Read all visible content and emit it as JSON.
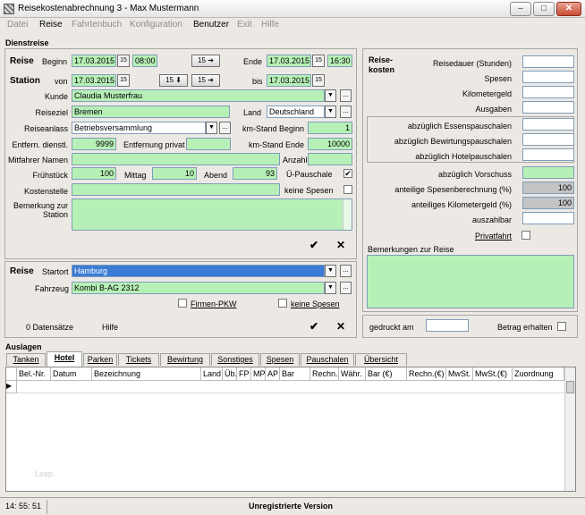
{
  "window": {
    "title": "Reisekostenabrechnung 3 - Max Mustermann",
    "minimize": "–",
    "maximize": "□",
    "close": "✕"
  },
  "menu": [
    {
      "label": "Datei",
      "enabled": false
    },
    {
      "label": "Reise",
      "enabled": true
    },
    {
      "label": "Fahrtenbuch",
      "enabled": false
    },
    {
      "label": "Konfiguration",
      "enabled": false
    },
    {
      "label": "Benutzer",
      "enabled": true
    },
    {
      "label": "Exit",
      "enabled": false
    },
    {
      "label": "Hilfe",
      "enabled": false
    }
  ],
  "dienstreise": {
    "section_title": "Dienstreise",
    "reise_label": "Reise",
    "beginn_label": "Beginn",
    "beginn_date": "17.03.2015",
    "beginn_time": "08:00",
    "ende_label": "Ende",
    "ende_date": "17.03.2015",
    "ende_time": "16:30",
    "calendar_icon_text": "15",
    "station_label": "Station",
    "von_label": "von",
    "von_date": "17.03.2015",
    "bis_label": "bis",
    "bis_date": "17.03.2015",
    "kunde_label": "Kunde",
    "kunde": "Claudia Musterfrau",
    "reiseziel_label": "Reiseziel",
    "reiseziel": "Bremen",
    "land_label": "Land",
    "land": "Deutschland",
    "reiseanlass_label": "Reiseanlass",
    "reiseanlass": "Betriebsversammlung",
    "km_beginn_label": "km-Stand Beginn",
    "km_beginn": "1",
    "entfern_dienstl_label": "Entfern. dienstl.",
    "entfern_dienstl": "9999",
    "entfern_privat_label": "Entfernung privat",
    "entfern_privat": "",
    "km_ende_label": "km-Stand Ende",
    "km_ende": "10000",
    "mitfahrer_label": "Mitfahrer Namen",
    "mitfahrer": "",
    "anzahl_label": "Anzahl",
    "anzahl": "",
    "fruehstueck_label": "Frühstück",
    "fruehstueck": "100",
    "mittag_label": "Mittag",
    "mittag": "10",
    "abend_label": "Abend",
    "abend": "93",
    "ue_pauschale_label": "Ü-Pauschale",
    "kostenstelle_label": "Kostenstelle",
    "kostenstelle": "",
    "keine_spesen_label": "keine Spesen",
    "bemerkung_label": "Bemerkung zur Station",
    "bemerkung": ""
  },
  "reise_bottom": {
    "reise_label": "Reise",
    "startort_label": "Startort",
    "startort": "Hamburg",
    "fahrzeug_label": "Fahrzeug",
    "fahrzeug": "Kombi B-AG 2312",
    "firmen_pkw_label": "Firmen-PKW",
    "keine_spesen_label": "keine Spesen",
    "datensaetze": "0 Datensätze",
    "hilfe": "Hilfe"
  },
  "reisekosten": {
    "title": "Reise-\nkosten",
    "reisedauer_label": "Reisedauer (Stunden)",
    "spesen_label": "Spesen",
    "kilometergeld_label": "Kilometergeld",
    "ausgaben_label": "Ausgaben",
    "essenspauschalen_label": "abzüglich Essenspauschalen",
    "bewirtung_label": "abzüglich Bewirtungspauschalen",
    "hotel_label": "abzüglich Hotelpauschalen",
    "vorschuss_label": "abzüglich Vorschuss",
    "spesenberechnung_label": "anteilige Spesenberechnung (%)",
    "spesenberechnung": "100",
    "kilometergeld_pct_label": "anteiliges Kilometergeld (%)",
    "kilometergeld_pct": "100",
    "auszahlbar_label": "auszahlbar",
    "privatfahrt_label": "Privatfahrt",
    "bemerkungen_label": "Bemerkungen zur Reise",
    "gedruckt_label": "gedruckt am",
    "betrag_label": "Betrag erhalten"
  },
  "auslagen": {
    "title": "Auslagen",
    "tabs": [
      "Tanken",
      "Hotel",
      "Parken",
      "Tickets",
      "Bewirtung",
      "Sonstiges",
      "Spesen",
      "Pauschalen",
      "Übersicht"
    ],
    "columns": [
      "Bel.-Nr.",
      "Datum",
      "Bezeichnung",
      "Land",
      "Üb.",
      "FP",
      "MP",
      "AP",
      "Bar",
      "Rechn.",
      "Währ.",
      "Bar (€)",
      "Rechn.(€)",
      "MwSt.",
      "MwSt.(€)",
      "Zuordnung"
    ],
    "watermark": "Leep."
  },
  "status": {
    "time": "14: 55: 51",
    "version": "Unregistrierte Version"
  },
  "actions": {
    "ok": "✔",
    "cancel": "✕",
    "ellipsis": "...",
    "combo": "▼",
    "arrow_down": "15 ⬇",
    "arrow_right": "15 ➔"
  },
  "colors": {
    "field_green": "#b7f0b7",
    "field_gray": "#c4c4c4",
    "selection_blue": "#3b7cd4"
  }
}
